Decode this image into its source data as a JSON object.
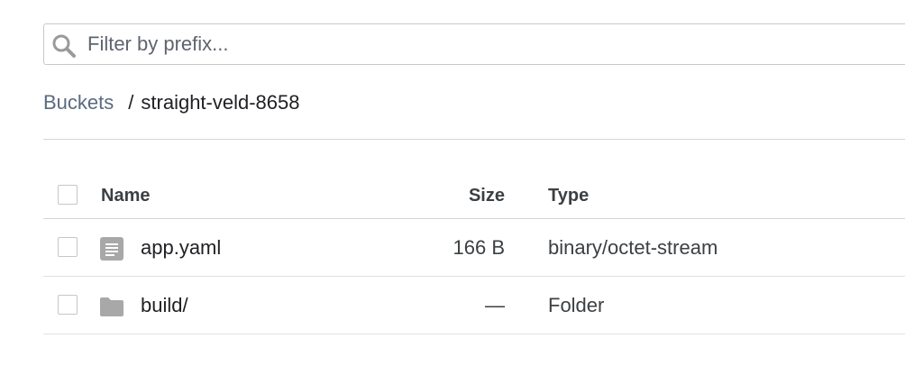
{
  "search": {
    "placeholder": "Filter by prefix...",
    "value": ""
  },
  "breadcrumb": {
    "root": "Buckets",
    "separator": "/",
    "current": "straight-veld-8658"
  },
  "table": {
    "columns": {
      "name": "Name",
      "size": "Size",
      "type": "Type"
    },
    "rows": [
      {
        "icon": "document-icon",
        "name": "app.yaml",
        "size": "166 B",
        "type": "binary/octet-stream"
      },
      {
        "icon": "folder-icon",
        "name": "build/",
        "size": "—",
        "type": "Folder"
      }
    ]
  },
  "colors": {
    "link": "#5b6a80",
    "icon": "#a8a8a8",
    "border": "#c9c9c9"
  }
}
